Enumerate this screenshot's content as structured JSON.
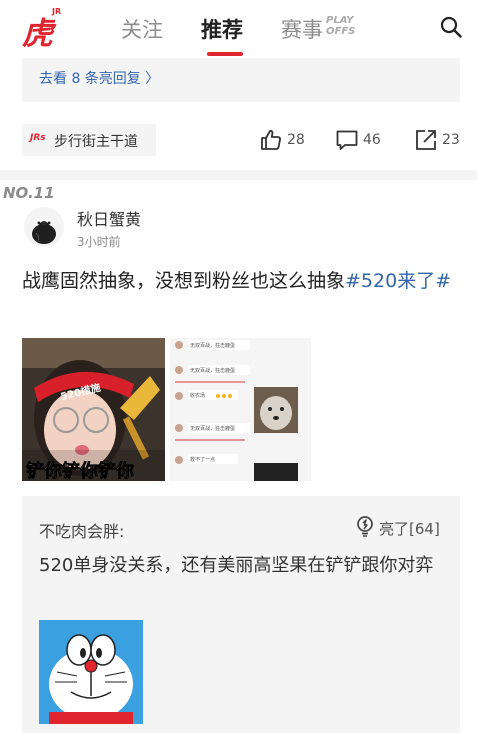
{
  "header": {
    "logo_text": "虎扑",
    "logo_badge": "JR",
    "tabs": [
      {
        "label": "关注"
      },
      {
        "label": "推荐"
      },
      {
        "label": "赛事"
      }
    ],
    "playoffs_badge": "PLAY OFFS",
    "active_tab_color": "#e0252f"
  },
  "previous_post": {
    "reply_link": "去看 8 条亮回复 〉",
    "topic": "步行街主干道",
    "topic_logo": "JRs",
    "likes": "28",
    "comments": "46",
    "shares": "23"
  },
  "post": {
    "rank": "NO.11",
    "author": "秋日蟹黄",
    "time": "3小时前",
    "text": "战鹰固然抽象，没想到粉丝也这么抽象",
    "hashtag": "#520来了#",
    "image1_caption": "铲你铲你铲你",
    "image1_badge": "520措施",
    "image2_lines": [
      "无双百战，狂击鹿蛋",
      "无双百战，狂击鹿蛋",
      "收农场",
      "无双百战，狂击鹿蛋",
      "救不了一点"
    ]
  },
  "hot_comment": {
    "user": "不吃肉会胖:",
    "liked": "亮了[64]",
    "text": "520单身没关系，还有美丽高坚果在铲铲跟你对弈"
  },
  "colors": {
    "brand": "#e0252f",
    "link": "#3465ad",
    "panel_bg": "#f4f4f5"
  }
}
